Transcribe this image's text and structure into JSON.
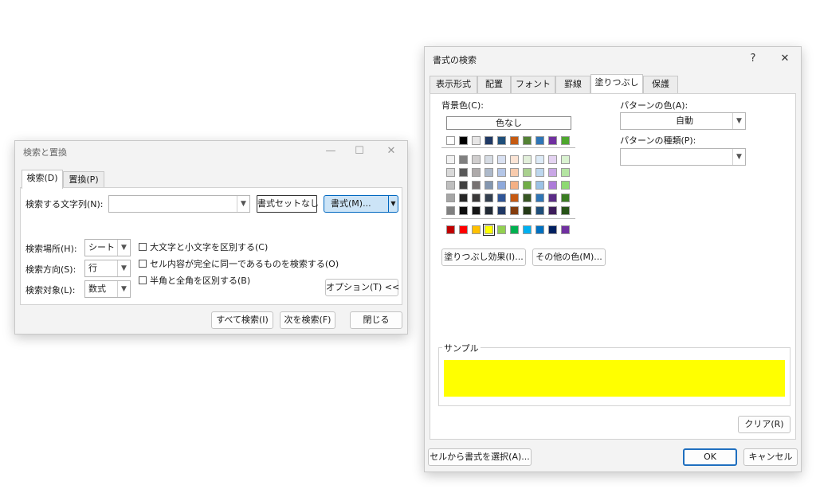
{
  "find_dialog": {
    "title": "検索と置換",
    "tabs": [
      "検索(D)",
      "置換(P)"
    ],
    "find_what_label": "検索する文字列(N):",
    "find_what_value": "",
    "no_format_button": "書式セットなし",
    "format_button": "書式(M)...",
    "within_label": "検索場所(H):",
    "within_value": "シート",
    "direction_label": "検索方向(S):",
    "direction_value": "行",
    "lookin_label": "検索対象(L):",
    "lookin_value": "数式",
    "match_case": "大文字と小文字を区別する(C)",
    "match_entire": "セル内容が完全に同一であるものを検索する(O)",
    "match_byte": "半角と全角を区別する(B)",
    "options_button": "オプション(T) <<",
    "find_all_button": "すべて検索(I)",
    "find_next_button": "次を検索(F)",
    "close_button": "閉じる"
  },
  "format_dialog": {
    "title": "書式の検索",
    "help": "?",
    "close": "✕",
    "tabs": [
      "表示形式",
      "配置",
      "フォント",
      "罫線",
      "塗りつぶし",
      "保護"
    ],
    "active_tab_index": 4,
    "background_label": "背景色(C):",
    "no_color": "色なし",
    "pattern_color_label": "パターンの色(A):",
    "pattern_color_value": "自動",
    "pattern_style_label": "パターンの種類(P):",
    "pattern_style_value": "",
    "fill_effects_button": "塗りつぶし効果(I)...",
    "more_colors_button": "その他の色(M)...",
    "sample_label": "サンプル",
    "sample_color": "#ffff00",
    "clear_button": "クリア(R)",
    "choose_from_cell_button": "セルから書式を選択(A)...",
    "ok_button": "OK",
    "cancel_button": "キャンセル",
    "theme_colors": [
      [
        "#ffffff",
        "#000000",
        "#e7e6e6",
        "#44546a",
        "#4472c4",
        "#ed7d31",
        "#a5a5a5",
        "#ffc000",
        "#5b9bd5",
        "#70ad47"
      ]
    ],
    "top_colors": [
      "#ffffff",
      "#000000",
      "#e7e6e6",
      "#1f3864",
      "#1f4e79",
      "#c55a11",
      "#548235",
      "#2e75b6",
      "#7030a0",
      "#4ea72e"
    ],
    "tint_colors": [
      [
        "#f2f2f2",
        "#808080",
        "#d0cece",
        "#d6dce4",
        "#d9e1f2",
        "#fbe4d5",
        "#e2efda",
        "#ddebf7",
        "#e4d3f2",
        "#d9f2d0"
      ],
      [
        "#d9d9d9",
        "#595959",
        "#aeaaaa",
        "#adb9ca",
        "#b4c6e7",
        "#f8cbad",
        "#a9d08e",
        "#bdd7ee",
        "#c9a7e6",
        "#b4e5a2"
      ],
      [
        "#bfbfbf",
        "#404040",
        "#767171",
        "#8497b0",
        "#8ea9db",
        "#f4b084",
        "#70ad47",
        "#9bc2e6",
        "#ad7bd9",
        "#8ed973"
      ],
      [
        "#a6a6a6",
        "#262626",
        "#3a3838",
        "#333f4f",
        "#2f5597",
        "#c65911",
        "#375623",
        "#2f75b5",
        "#5b2c87",
        "#3a7d22"
      ],
      [
        "#808080",
        "#0d0d0d",
        "#161616",
        "#222a35",
        "#203864",
        "#843c0c",
        "#253a17",
        "#1f4e79",
        "#3c1d5a",
        "#275317"
      ]
    ],
    "standard_colors": [
      "#c00000",
      "#ff0000",
      "#ffc000",
      "#ffff00",
      "#92d050",
      "#00b050",
      "#00b0f0",
      "#0070c0",
      "#002060",
      "#7030a0"
    ],
    "selected_standard_index": 3
  }
}
